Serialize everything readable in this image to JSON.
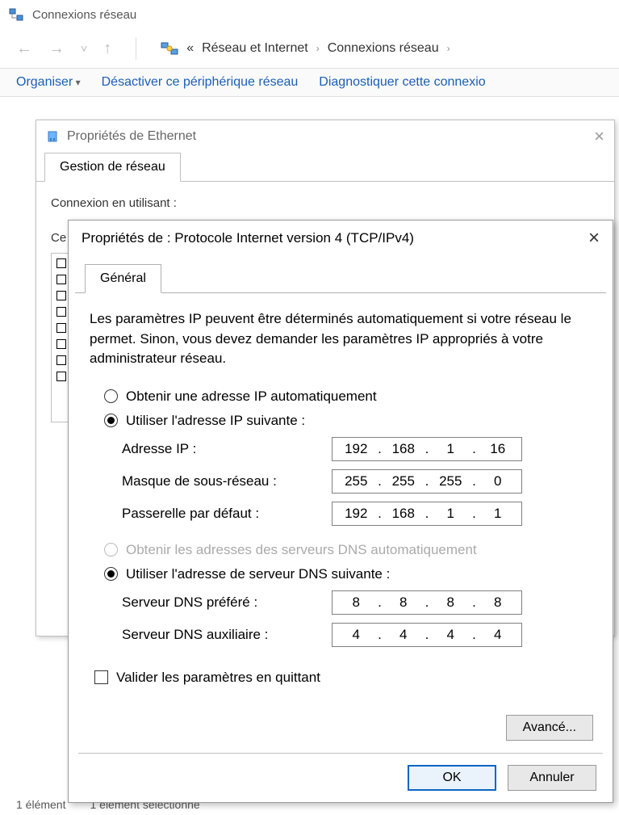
{
  "explorer": {
    "title": "Connexions réseau",
    "breadcrumb": {
      "prefix": "«",
      "items": [
        "Réseau et Internet",
        "Connexions réseau"
      ]
    },
    "toolbar": {
      "organize": "Organiser",
      "disable": "Désactiver ce périphérique réseau",
      "diagnose": "Diagnostiquer cette connexio"
    },
    "status": {
      "count": "1 élément",
      "selected": "1 élément sélectionné"
    }
  },
  "ethDialog": {
    "title": "Propriétés de Ethernet",
    "tab": "Gestion de réseau",
    "connLabel": "Connexion en utilisant :",
    "ceLabel": "Ce"
  },
  "ipDialog": {
    "title": "Propriétés de : Protocole Internet version 4 (TCP/IPv4)",
    "tab": "Général",
    "description": "Les paramètres IP peuvent être déterminés automatiquement si votre réseau le permet. Sinon, vous devez demander les paramètres IP appropriés à votre administrateur réseau.",
    "radio_ip_auto": "Obtenir une adresse IP automatiquement",
    "radio_ip_manual": "Utiliser l'adresse IP suivante :",
    "labels": {
      "ip": "Adresse IP :",
      "mask": "Masque de sous-réseau :",
      "gateway": "Passerelle par défaut :",
      "dns1": "Serveur DNS préféré :",
      "dns2": "Serveur DNS auxiliaire :"
    },
    "values": {
      "ip": [
        "192",
        "168",
        "1",
        "16"
      ],
      "mask": [
        "255",
        "255",
        "255",
        "0"
      ],
      "gateway": [
        "192",
        "168",
        "1",
        "1"
      ],
      "dns1": [
        "8",
        "8",
        "8",
        "8"
      ],
      "dns2": [
        "4",
        "4",
        "4",
        "4"
      ]
    },
    "radio_dns_auto": "Obtenir les adresses des serveurs DNS automatiquement",
    "radio_dns_manual": "Utiliser l'adresse de serveur DNS suivante :",
    "validate": "Valider les paramètres en quittant",
    "advanced": "Avancé...",
    "ok": "OK",
    "cancel": "Annuler"
  }
}
